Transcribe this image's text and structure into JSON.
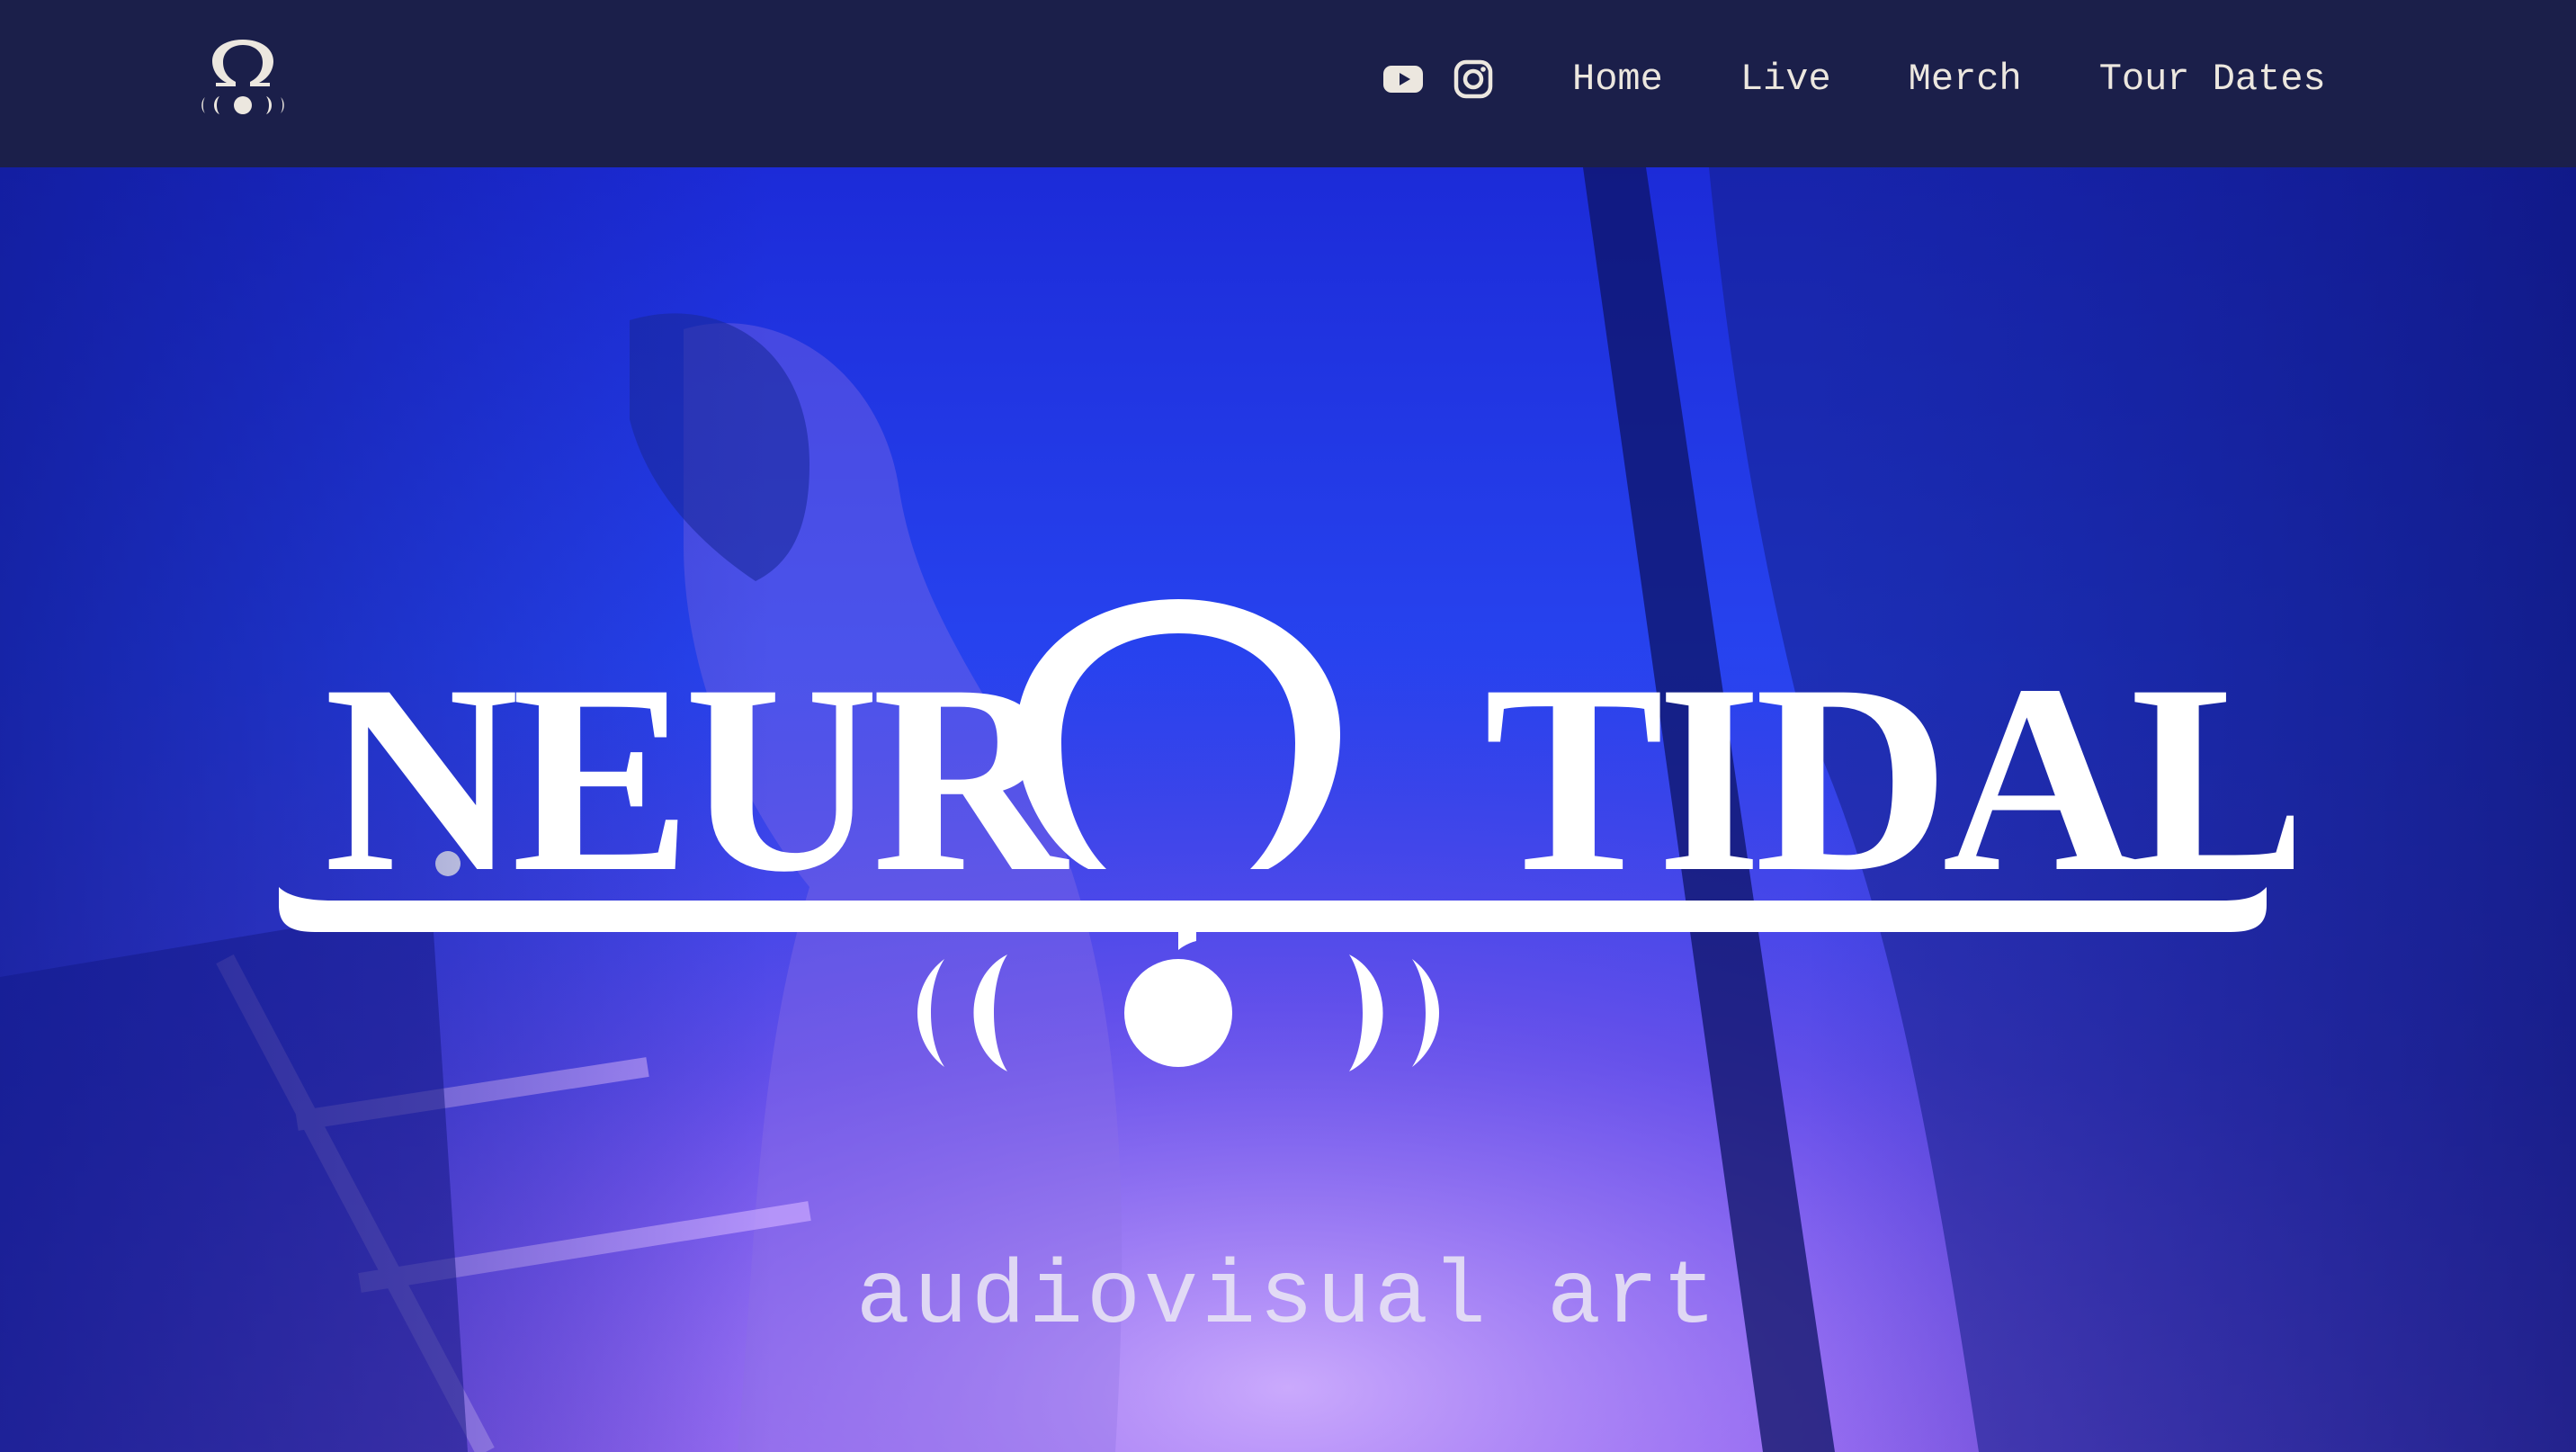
{
  "header": {
    "logo_name": "omega-moon-logo",
    "social": [
      {
        "name": "youtube-icon"
      },
      {
        "name": "instagram-icon"
      }
    ],
    "nav": [
      {
        "label": "Home"
      },
      {
        "label": "Live"
      },
      {
        "label": "Merch"
      },
      {
        "label": "Tour Dates"
      }
    ]
  },
  "hero": {
    "logo_text": "NEUROTIDAL",
    "tagline": "audiovisual art"
  },
  "colors": {
    "header_bg": "#1b1f4a",
    "nav_text": "#ece7df",
    "hero_blue": "#2743ef",
    "hero_violet": "#8d63ef",
    "logo_white": "#ffffff"
  }
}
